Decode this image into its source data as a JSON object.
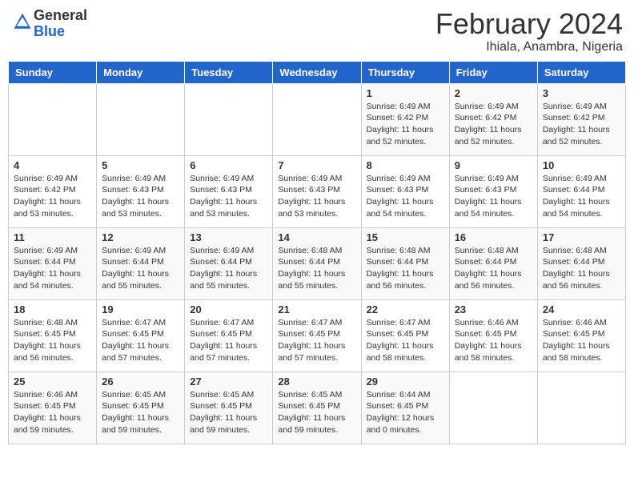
{
  "logo": {
    "general": "General",
    "blue": "Blue"
  },
  "header": {
    "title": "February 2024",
    "subtitle": "Ihiala, Anambra, Nigeria"
  },
  "weekdays": [
    "Sunday",
    "Monday",
    "Tuesday",
    "Wednesday",
    "Thursday",
    "Friday",
    "Saturday"
  ],
  "weeks": [
    [
      {
        "day": "",
        "info": ""
      },
      {
        "day": "",
        "info": ""
      },
      {
        "day": "",
        "info": ""
      },
      {
        "day": "",
        "info": ""
      },
      {
        "day": "1",
        "info": "Sunrise: 6:49 AM\nSunset: 6:42 PM\nDaylight: 11 hours\nand 52 minutes."
      },
      {
        "day": "2",
        "info": "Sunrise: 6:49 AM\nSunset: 6:42 PM\nDaylight: 11 hours\nand 52 minutes."
      },
      {
        "day": "3",
        "info": "Sunrise: 6:49 AM\nSunset: 6:42 PM\nDaylight: 11 hours\nand 52 minutes."
      }
    ],
    [
      {
        "day": "4",
        "info": "Sunrise: 6:49 AM\nSunset: 6:42 PM\nDaylight: 11 hours\nand 53 minutes."
      },
      {
        "day": "5",
        "info": "Sunrise: 6:49 AM\nSunset: 6:43 PM\nDaylight: 11 hours\nand 53 minutes."
      },
      {
        "day": "6",
        "info": "Sunrise: 6:49 AM\nSunset: 6:43 PM\nDaylight: 11 hours\nand 53 minutes."
      },
      {
        "day": "7",
        "info": "Sunrise: 6:49 AM\nSunset: 6:43 PM\nDaylight: 11 hours\nand 53 minutes."
      },
      {
        "day": "8",
        "info": "Sunrise: 6:49 AM\nSunset: 6:43 PM\nDaylight: 11 hours\nand 54 minutes."
      },
      {
        "day": "9",
        "info": "Sunrise: 6:49 AM\nSunset: 6:43 PM\nDaylight: 11 hours\nand 54 minutes."
      },
      {
        "day": "10",
        "info": "Sunrise: 6:49 AM\nSunset: 6:44 PM\nDaylight: 11 hours\nand 54 minutes."
      }
    ],
    [
      {
        "day": "11",
        "info": "Sunrise: 6:49 AM\nSunset: 6:44 PM\nDaylight: 11 hours\nand 54 minutes."
      },
      {
        "day": "12",
        "info": "Sunrise: 6:49 AM\nSunset: 6:44 PM\nDaylight: 11 hours\nand 55 minutes."
      },
      {
        "day": "13",
        "info": "Sunrise: 6:49 AM\nSunset: 6:44 PM\nDaylight: 11 hours\nand 55 minutes."
      },
      {
        "day": "14",
        "info": "Sunrise: 6:48 AM\nSunset: 6:44 PM\nDaylight: 11 hours\nand 55 minutes."
      },
      {
        "day": "15",
        "info": "Sunrise: 6:48 AM\nSunset: 6:44 PM\nDaylight: 11 hours\nand 56 minutes."
      },
      {
        "day": "16",
        "info": "Sunrise: 6:48 AM\nSunset: 6:44 PM\nDaylight: 11 hours\nand 56 minutes."
      },
      {
        "day": "17",
        "info": "Sunrise: 6:48 AM\nSunset: 6:44 PM\nDaylight: 11 hours\nand 56 minutes."
      }
    ],
    [
      {
        "day": "18",
        "info": "Sunrise: 6:48 AM\nSunset: 6:45 PM\nDaylight: 11 hours\nand 56 minutes."
      },
      {
        "day": "19",
        "info": "Sunrise: 6:47 AM\nSunset: 6:45 PM\nDaylight: 11 hours\nand 57 minutes."
      },
      {
        "day": "20",
        "info": "Sunrise: 6:47 AM\nSunset: 6:45 PM\nDaylight: 11 hours\nand 57 minutes."
      },
      {
        "day": "21",
        "info": "Sunrise: 6:47 AM\nSunset: 6:45 PM\nDaylight: 11 hours\nand 57 minutes."
      },
      {
        "day": "22",
        "info": "Sunrise: 6:47 AM\nSunset: 6:45 PM\nDaylight: 11 hours\nand 58 minutes."
      },
      {
        "day": "23",
        "info": "Sunrise: 6:46 AM\nSunset: 6:45 PM\nDaylight: 11 hours\nand 58 minutes."
      },
      {
        "day": "24",
        "info": "Sunrise: 6:46 AM\nSunset: 6:45 PM\nDaylight: 11 hours\nand 58 minutes."
      }
    ],
    [
      {
        "day": "25",
        "info": "Sunrise: 6:46 AM\nSunset: 6:45 PM\nDaylight: 11 hours\nand 59 minutes."
      },
      {
        "day": "26",
        "info": "Sunrise: 6:45 AM\nSunset: 6:45 PM\nDaylight: 11 hours\nand 59 minutes."
      },
      {
        "day": "27",
        "info": "Sunrise: 6:45 AM\nSunset: 6:45 PM\nDaylight: 11 hours\nand 59 minutes."
      },
      {
        "day": "28",
        "info": "Sunrise: 6:45 AM\nSunset: 6:45 PM\nDaylight: 11 hours\nand 59 minutes."
      },
      {
        "day": "29",
        "info": "Sunrise: 6:44 AM\nSunset: 6:45 PM\nDaylight: 12 hours\nand 0 minutes."
      },
      {
        "day": "",
        "info": ""
      },
      {
        "day": "",
        "info": ""
      }
    ]
  ]
}
